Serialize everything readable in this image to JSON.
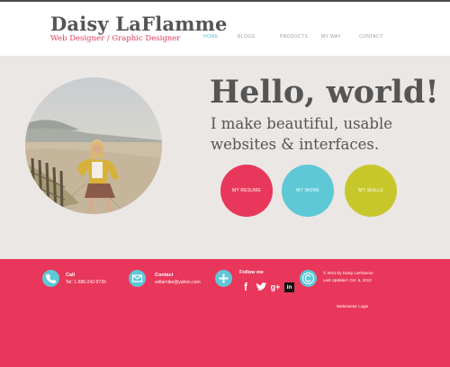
{
  "header": {
    "name": "Daisy LaFlamme",
    "tagline": "Web Designer / Graphic Designer",
    "nav": [
      "HOME",
      "BLOGS",
      "PRODUCTS",
      "MY WAY",
      "CONTACT"
    ]
  },
  "hero": {
    "greeting": "Hello, world!",
    "intro_line1": "I make beautiful, usable",
    "intro_line2": "websites & interfaces.",
    "buttons": [
      "MY RESUME",
      "MY WORK",
      "MY SKILLS"
    ]
  },
  "footer": {
    "call_title": "Call",
    "call_text": "Tel: 1-586-242-9726",
    "contact_title": "Contact",
    "contact_text": "wdlarnike@yahoo.com",
    "follow_title": "Follow me",
    "social": [
      "f",
      "twitter",
      "g+",
      "in"
    ],
    "copyright_line1": "© 2013 by Daisy LaFlamme",
    "copyright_line2": "Last Updated: Oct. 5, 2013",
    "admin_link": "Webmaster Login"
  },
  "icons": {
    "phone": "phone-icon",
    "mail": "envelope-icon",
    "plus": "plus-icon",
    "copyright": "copyright-icon"
  },
  "colors": {
    "accent_pink": "#e8375a",
    "accent_teal": "#5ec8d6",
    "accent_lime": "#c7c72c",
    "text_gray": "#555555",
    "hero_bg": "#ebe7e4"
  }
}
